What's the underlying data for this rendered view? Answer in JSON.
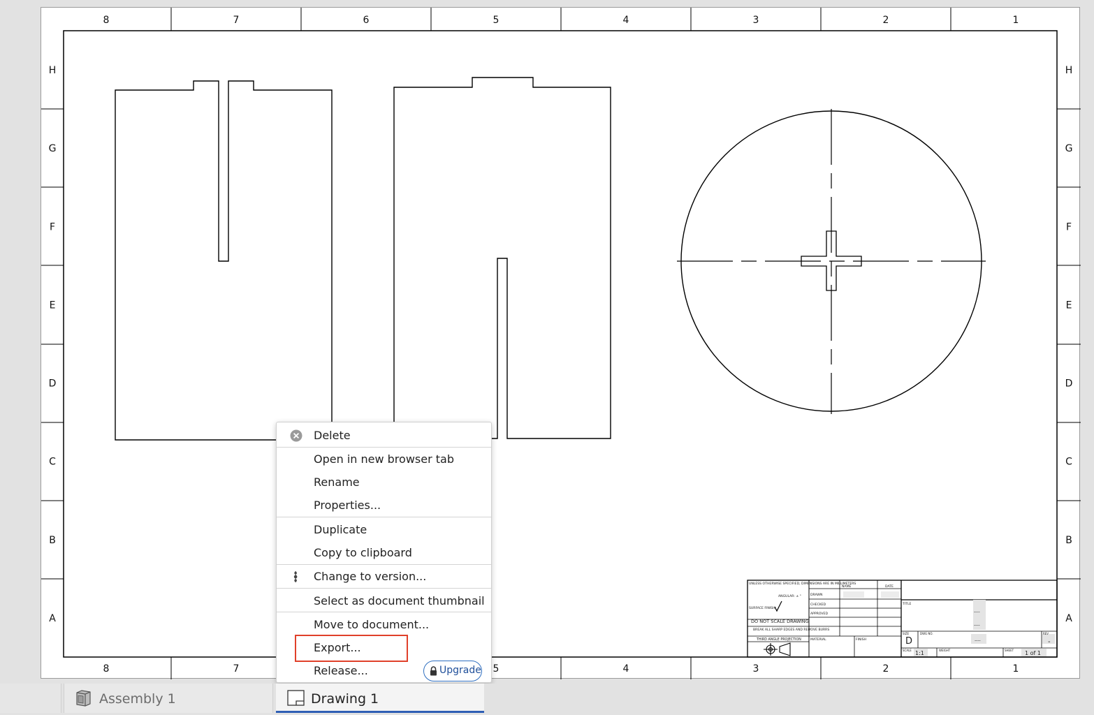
{
  "sheet": {
    "zone_columns": [
      "8",
      "7",
      "6",
      "5",
      "4",
      "3",
      "2",
      "1"
    ],
    "zone_rows": [
      "H",
      "G",
      "F",
      "E",
      "D",
      "C",
      "B",
      "A"
    ]
  },
  "title_block": {
    "notes": "UNLESS OTHERWISE SPECIFIED, DIMENSIONS ARE IN MILLIMETERS",
    "angular": "ANGULAR: ± °",
    "surface_finish": "SURFACE FINISH:",
    "do_not_scale": "DO NOT SCALE DRAWING",
    "break_edges": "BREAK ALL SHARP EDGES AND REMOVE BURRS",
    "projection": "THIRD ANGLE PROJECTION",
    "name_header": "NAME",
    "date_header": "DATE",
    "drawn": "DRAWN",
    "checked": "CHECKED",
    "approved": "APPROVED",
    "material": "MATERIAL",
    "finish": "FINISH",
    "title": "TITLE",
    "size_label": "SIZE",
    "dwg_no": "DWG NO.",
    "rev": "REV",
    "size": "D",
    "dash": "-",
    "dashes": "----",
    "scale_label": "SCALE",
    "scale": "1:1",
    "weight": "WEIGHT",
    "sheet_label": "SHEET",
    "sheet": "1 of 1"
  },
  "context_menu": {
    "items": [
      {
        "label": "Delete",
        "icon": "delete-circle-x-icon"
      },
      {
        "label": "Open in new browser tab"
      },
      {
        "label": "Rename"
      },
      {
        "label": "Properties..."
      },
      {
        "label": "Duplicate"
      },
      {
        "label": "Copy to clipboard"
      },
      {
        "label": "Change to version...",
        "icon": "version-graph-icon"
      },
      {
        "label": "Select as document thumbnail"
      },
      {
        "label": "Move to document..."
      },
      {
        "label": "Export..."
      },
      {
        "label": "Release..."
      }
    ],
    "upgrade_label": "Upgrade"
  },
  "tabs": [
    {
      "label": "",
      "active": false
    },
    {
      "label": "Assembly 1",
      "icon": "assembly-cube-icon",
      "active": false
    },
    {
      "label": "Drawing 1",
      "icon": "drawing-sheet-icon",
      "active": true
    }
  ],
  "colors": {
    "highlight": "#e0402a",
    "upgrade": "#2f6fc0",
    "active_tab_underline": "#2f5fb5"
  }
}
